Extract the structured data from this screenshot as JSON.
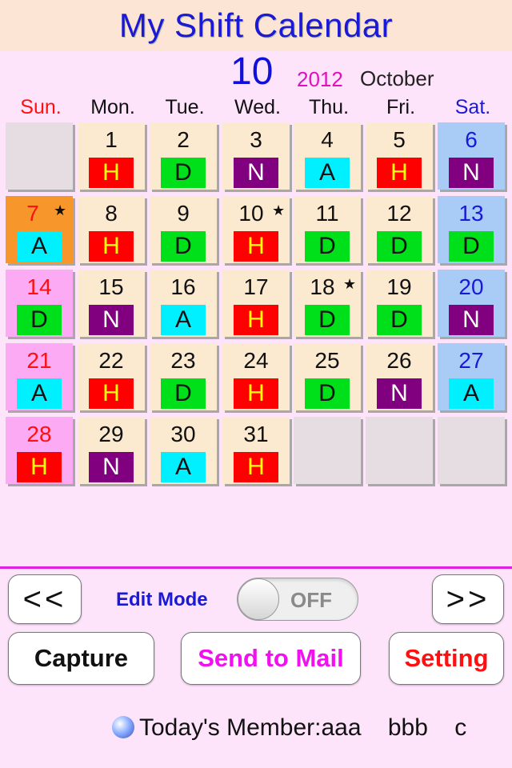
{
  "header": {
    "title": "My Shift Calendar"
  },
  "month": {
    "number": "10",
    "year": "2012",
    "name": "October"
  },
  "weekdays": [
    {
      "label": "Sun.",
      "color": "#ff1010"
    },
    {
      "label": "Mon.",
      "color": "#111111"
    },
    {
      "label": "Tue.",
      "color": "#111111"
    },
    {
      "label": "Wed.",
      "color": "#111111"
    },
    {
      "label": "Thu.",
      "color": "#111111"
    },
    {
      "label": "Fri.",
      "color": "#111111"
    },
    {
      "label": "Sat.",
      "color": "#1a1ad6"
    }
  ],
  "colors": {
    "weekday_bg": "#fbe9d0",
    "sunday_bg": "#fbaaf3",
    "saturday_bg": "#a9ccf7",
    "today_bg": "#f7962a",
    "empty_bg": "#e6dde3",
    "sunday_text": "#ff1010",
    "saturday_text": "#1a1ad6"
  },
  "shift_types": {
    "H": {
      "bg": "#ff0000",
      "fg": "#ffff00"
    },
    "D": {
      "bg": "#00e01a",
      "fg": "#111111"
    },
    "N": {
      "bg": "#800080",
      "fg": "#ffffff"
    },
    "A": {
      "bg": "#00f0ff",
      "fg": "#111111"
    }
  },
  "weeks": [
    [
      {
        "day": "",
        "shift": ""
      },
      {
        "day": "1",
        "shift": "H"
      },
      {
        "day": "2",
        "shift": "D"
      },
      {
        "day": "3",
        "shift": "N"
      },
      {
        "day": "4",
        "shift": "A"
      },
      {
        "day": "5",
        "shift": "H"
      },
      {
        "day": "6",
        "shift": "N"
      }
    ],
    [
      {
        "day": "7",
        "shift": "A",
        "star": true,
        "today": true
      },
      {
        "day": "8",
        "shift": "H"
      },
      {
        "day": "9",
        "shift": "D"
      },
      {
        "day": "10",
        "shift": "H",
        "star": true
      },
      {
        "day": "11",
        "shift": "D"
      },
      {
        "day": "12",
        "shift": "D"
      },
      {
        "day": "13",
        "shift": "D"
      }
    ],
    [
      {
        "day": "14",
        "shift": "D"
      },
      {
        "day": "15",
        "shift": "N"
      },
      {
        "day": "16",
        "shift": "A"
      },
      {
        "day": "17",
        "shift": "H"
      },
      {
        "day": "18",
        "shift": "D",
        "star": true
      },
      {
        "day": "19",
        "shift": "D"
      },
      {
        "day": "20",
        "shift": "N"
      }
    ],
    [
      {
        "day": "21",
        "shift": "A"
      },
      {
        "day": "22",
        "shift": "H"
      },
      {
        "day": "23",
        "shift": "D"
      },
      {
        "day": "24",
        "shift": "H"
      },
      {
        "day": "25",
        "shift": "D"
      },
      {
        "day": "26",
        "shift": "N"
      },
      {
        "day": "27",
        "shift": "A"
      }
    ],
    [
      {
        "day": "28",
        "shift": "H"
      },
      {
        "day": "29",
        "shift": "N"
      },
      {
        "day": "30",
        "shift": "A"
      },
      {
        "day": "31",
        "shift": "H"
      },
      {
        "day": "",
        "shift": ""
      },
      {
        "day": "",
        "shift": ""
      },
      {
        "day": "",
        "shift": ""
      }
    ]
  ],
  "star_glyph": "★",
  "controls": {
    "prev_label": "<<",
    "next_label": ">>",
    "edit_mode_label": "Edit Mode",
    "edit_mode_state": "OFF",
    "capture_label": "Capture",
    "send_mail_label": "Send to Mail",
    "send_mail_color": "#f010f0",
    "setting_label": "Setting",
    "setting_color": "#ff1010"
  },
  "member": {
    "text": "Today's Member:aaa    bbb    c"
  }
}
